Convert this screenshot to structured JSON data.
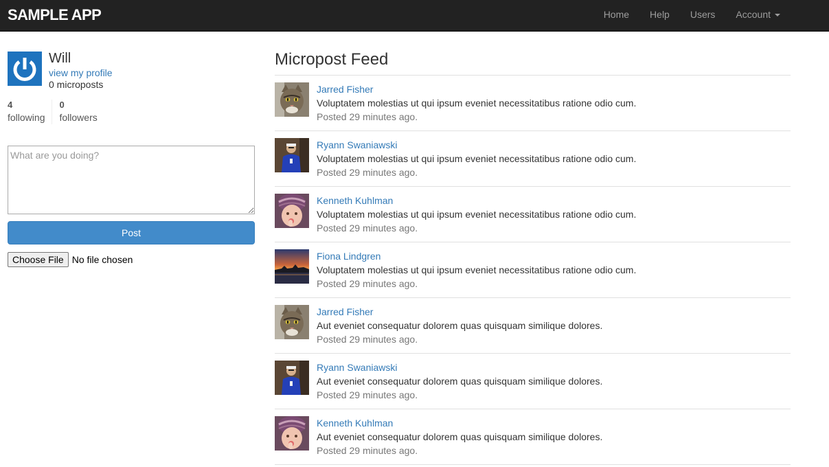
{
  "navbar": {
    "brand": "sample app",
    "links": [
      "Home",
      "Help",
      "Users"
    ],
    "account": "Account"
  },
  "user": {
    "name": "Will",
    "profile_link": "view my profile",
    "microposts": "0 microposts",
    "following_count": "4",
    "following_label": "following",
    "followers_count": "0",
    "followers_label": "followers",
    "gravatar_color": "#1e73be"
  },
  "form": {
    "placeholder": "What are you doing?",
    "post_label": "Post",
    "file_button": "Choose File",
    "file_status": "No file chosen"
  },
  "feed": {
    "title": "Micropost Feed",
    "items": [
      {
        "user": "Jarred Fisher",
        "content": "Voluptatem molestias ut qui ipsum eveniet necessitatibus ratione odio cum.",
        "time": "Posted 29 minutes ago.",
        "avatar": "cat-avatar-icon"
      },
      {
        "user": "Ryann Swaniawski",
        "content": "Voluptatem molestias ut qui ipsum eveniet necessitatibus ratione odio cum.",
        "time": "Posted 29 minutes ago.",
        "avatar": "person-blue-avatar-icon"
      },
      {
        "user": "Kenneth Kuhlman",
        "content": "Voluptatem molestias ut qui ipsum eveniet necessitatibus ratione odio cum.",
        "time": "Posted 29 minutes ago.",
        "avatar": "child-avatar-icon"
      },
      {
        "user": "Fiona Lindgren",
        "content": "Voluptatem molestias ut qui ipsum eveniet necessitatibus ratione odio cum.",
        "time": "Posted 29 minutes ago.",
        "avatar": "sunset-avatar-icon"
      },
      {
        "user": "Jarred Fisher",
        "content": "Aut eveniet consequatur dolorem quas quisquam similique dolores.",
        "time": "Posted 29 minutes ago.",
        "avatar": "cat-avatar-icon"
      },
      {
        "user": "Ryann Swaniawski",
        "content": "Aut eveniet consequatur dolorem quas quisquam similique dolores.",
        "time": "Posted 29 minutes ago.",
        "avatar": "person-blue-avatar-icon"
      },
      {
        "user": "Kenneth Kuhlman",
        "content": "Aut eveniet consequatur dolorem quas quisquam similique dolores.",
        "time": "Posted 29 minutes ago.",
        "avatar": "child-avatar-icon"
      }
    ]
  }
}
